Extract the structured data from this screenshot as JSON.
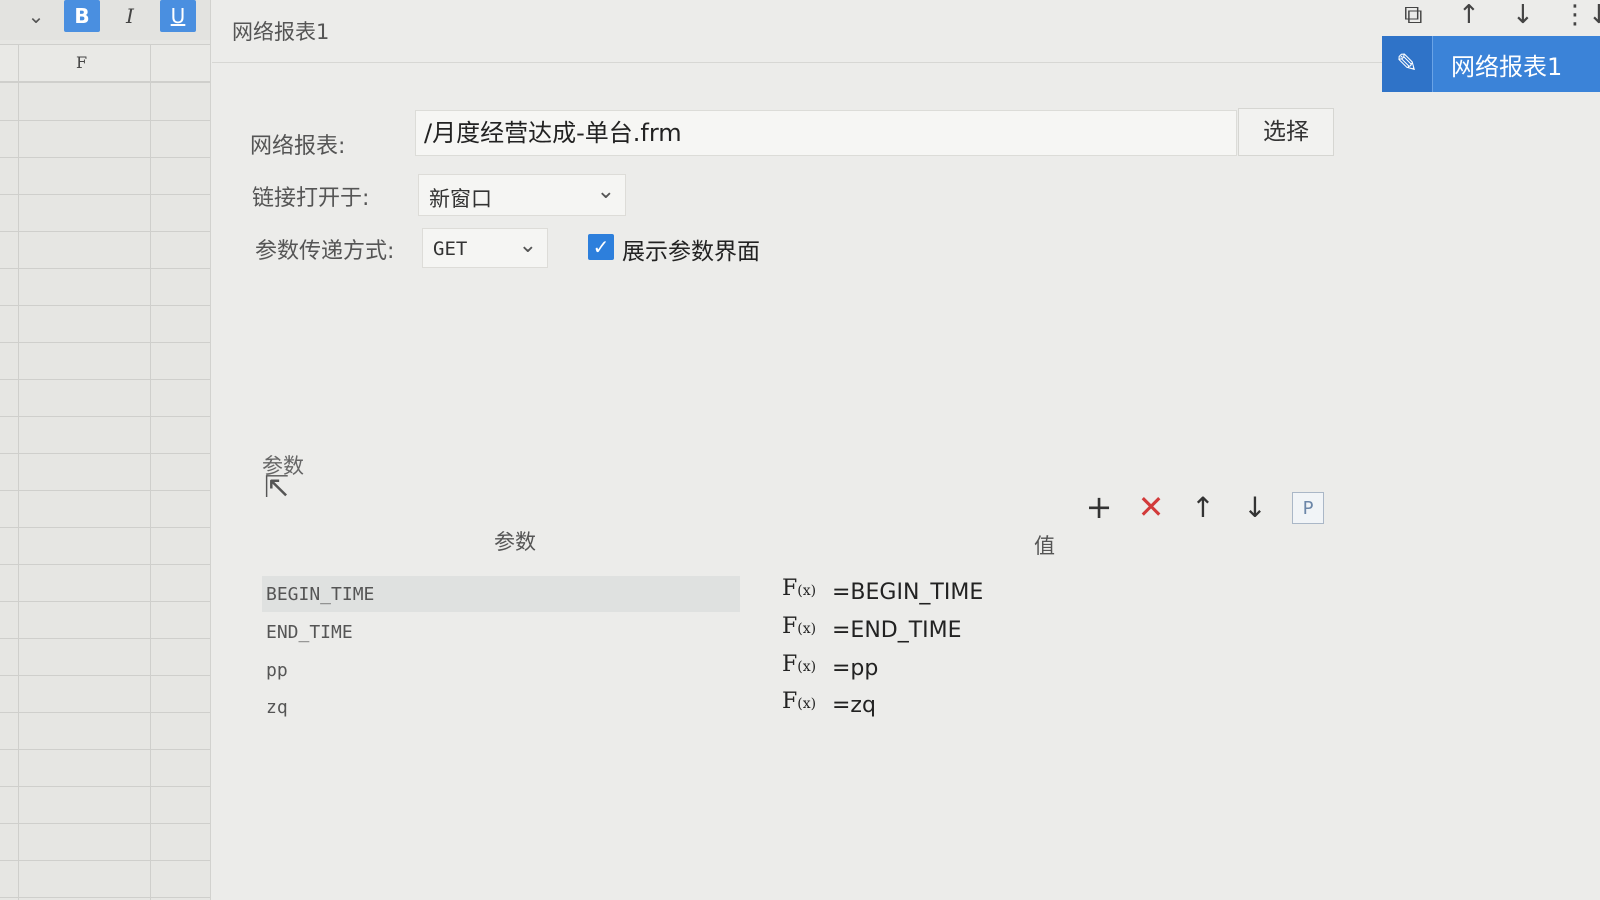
{
  "toolbar": {
    "bold": "B",
    "italic": "I",
    "underline": "U",
    "dropdown_icon": "chevron-down-icon"
  },
  "sheet": {
    "column_header": "F"
  },
  "dialog": {
    "title": "网络报表1"
  },
  "right_panel": {
    "tab_label": "网络报表1",
    "icons": [
      "copy-icon",
      "arrow-up-icon",
      "arrow-down-icon",
      "more-icon"
    ]
  },
  "form": {
    "report_label": "网络报表:",
    "report_value": "/月度经营达成-单台.frm",
    "choose_button": "选择",
    "open_in_label": "链接打开于:",
    "open_in_value": "新窗口",
    "method_label": "参数传递方式:",
    "method_value": "GET",
    "show_params_label": "展示参数界面",
    "show_params_checked": true
  },
  "params": {
    "section_label": "参数",
    "header_param": "参数",
    "header_value": "值",
    "fx_label": "F",
    "fx_sub": "(x)",
    "rows": [
      {
        "name": "BEGIN_TIME",
        "value": "=BEGIN_TIME"
      },
      {
        "name": "END_TIME",
        "value": "=END_TIME"
      },
      {
        "name": "pp",
        "value": "=pp"
      },
      {
        "name": "zq",
        "value": "=zq"
      }
    ],
    "p_button": "P"
  },
  "colors": {
    "accent": "#3b83d8",
    "delete": "#d23a3a",
    "checkbox": "#2d7fdc"
  }
}
